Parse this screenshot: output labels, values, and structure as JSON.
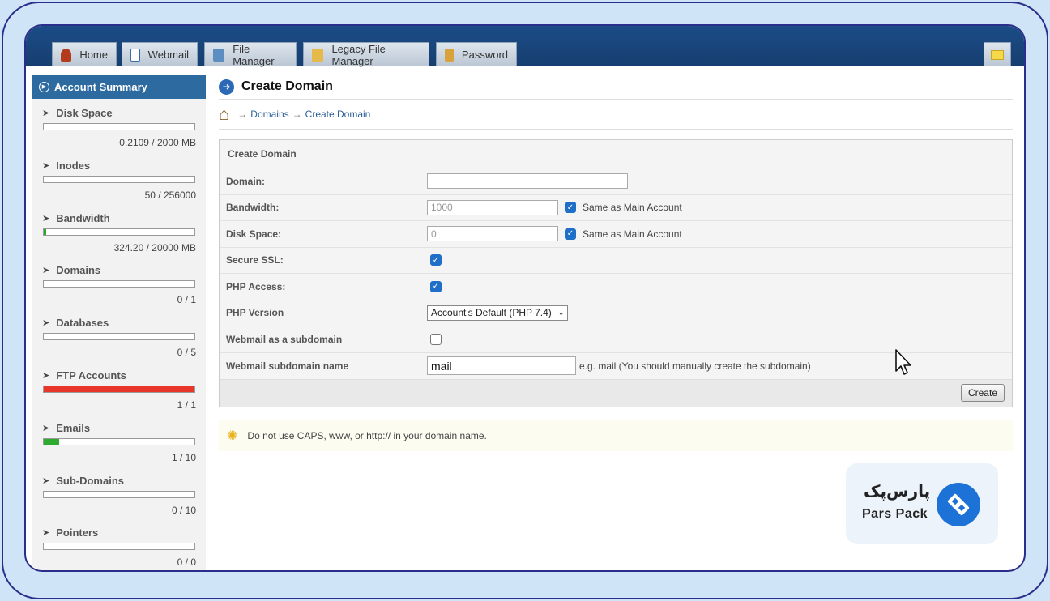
{
  "nav": {
    "tabs": [
      {
        "label": "Home",
        "icon": "home-icon"
      },
      {
        "label": "Webmail",
        "icon": "mail-icon"
      },
      {
        "label": "File Manager",
        "icon": "file-manager-icon"
      },
      {
        "label": "Legacy File Manager",
        "icon": "folder-icon"
      },
      {
        "label": "Password",
        "icon": "password-icon"
      }
    ]
  },
  "sidebar": {
    "title": "Account Summary",
    "stats": [
      {
        "label": "Disk Space",
        "value": "0.2109 / 2000 MB",
        "fill": 0.0,
        "color": "#2eaa2e"
      },
      {
        "label": "Inodes",
        "value": "50 / 256000",
        "fill": 0.0,
        "color": "#2eaa2e"
      },
      {
        "label": "Bandwidth",
        "value": "324.20 / 20000 MB",
        "fill": 0.016,
        "color": "#2eaa2e"
      },
      {
        "label": "Domains",
        "value": "0 / 1",
        "fill": 0.0,
        "color": "#2eaa2e"
      },
      {
        "label": "Databases",
        "value": "0 / 5",
        "fill": 0.0,
        "color": "#2eaa2e"
      },
      {
        "label": "FTP Accounts",
        "value": "1 / 1",
        "fill": 1.0,
        "color": "#e8362a"
      },
      {
        "label": "Emails",
        "value": "1 / 10",
        "fill": 0.1,
        "color": "#2eaa2e"
      },
      {
        "label": "Sub-Domains",
        "value": "0 / 10",
        "fill": 0.0,
        "color": "#2eaa2e"
      },
      {
        "label": "Pointers",
        "value": "0 / 0",
        "fill": 0.0,
        "color": "#2eaa2e"
      }
    ]
  },
  "main": {
    "title": "Create Domain",
    "breadcrumb": {
      "domains": "Domains",
      "current": "Create Domain"
    },
    "form": {
      "heading": "Create Domain",
      "domain_label": "Domain:",
      "bandwidth_label": "Bandwidth:",
      "bandwidth_value": "1000",
      "bandwidth_same": "Same as Main Account",
      "disk_label": "Disk Space:",
      "disk_value": "0",
      "disk_same": "Same as Main Account",
      "ssl_label": "Secure SSL:",
      "php_access_label": "PHP Access:",
      "php_version_label": "PHP Version",
      "php_version_value": "Account's Default (PHP 7.4)",
      "webmail_sub_label": "Webmail as a subdomain",
      "webmail_name_label": "Webmail subdomain name",
      "webmail_name_value": "mail",
      "webmail_name_hint": "e.g. mail (You should manually create the subdomain)",
      "create_button": "Create"
    },
    "tip": "Do not use CAPS, www, or http:// in your domain name."
  },
  "brand": {
    "fa": "پارس‌پک",
    "en": "Pars Pack"
  }
}
